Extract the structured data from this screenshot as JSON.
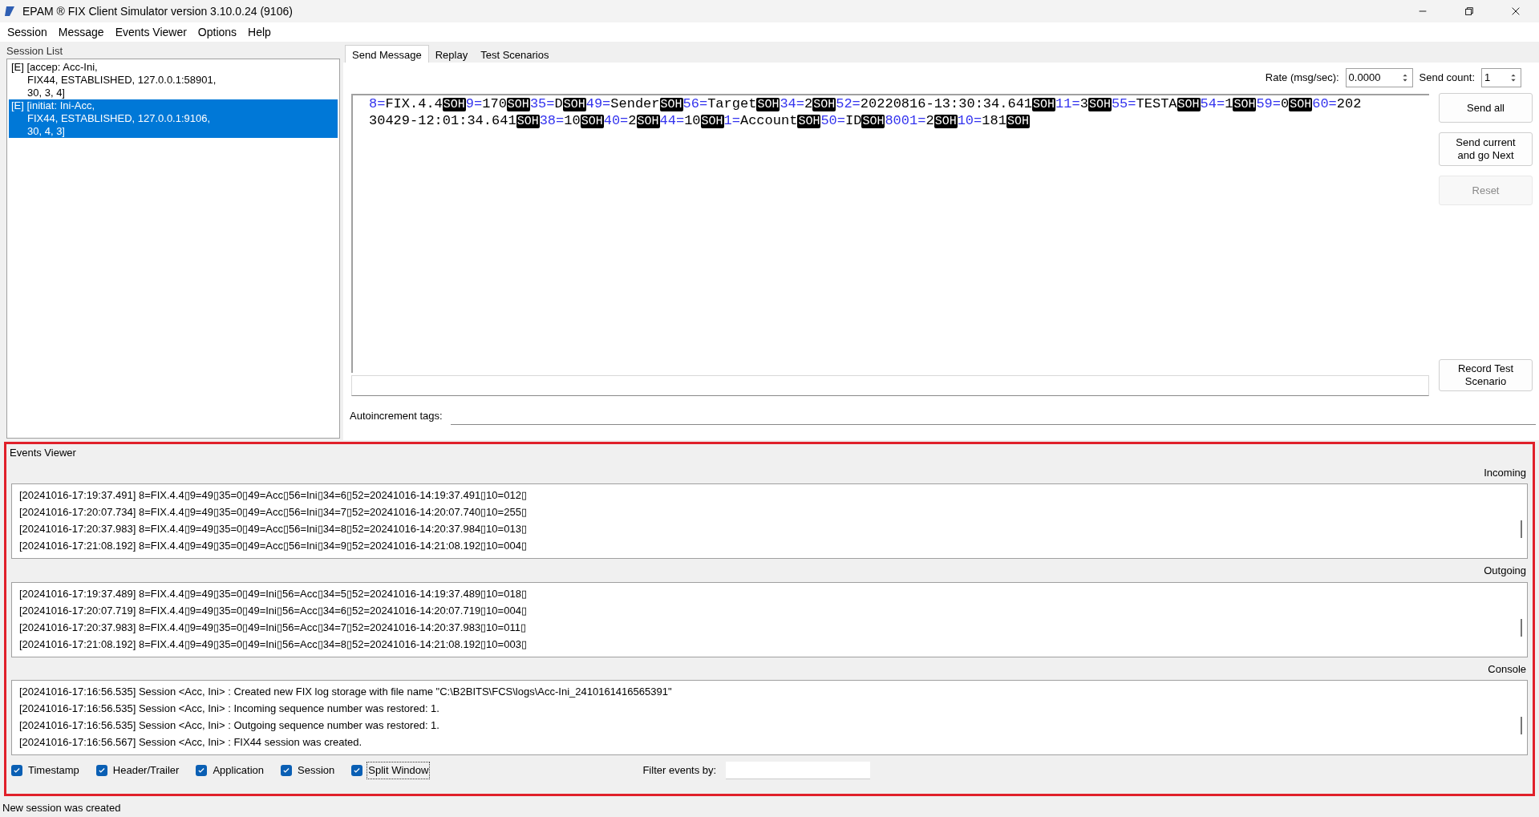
{
  "window": {
    "title": "EPAM ® FIX Client Simulator version 3.10.0.24 (9106)"
  },
  "menu": [
    "Session",
    "Message",
    "Events Viewer",
    "Options",
    "Help"
  ],
  "session_list": {
    "title": "Session List",
    "items": [
      {
        "lines": [
          "[E] [accep: Acc-Ini,",
          "FIX44, ESTABLISHED, 127.0.0.1:58901,",
          "30, 3, 4]"
        ],
        "selected": false
      },
      {
        "lines": [
          "[E] [initiat: Ini-Acc,",
          "FIX44, ESTABLISHED, 127.0.0.1:9106,",
          "30, 4, 3]"
        ],
        "selected": true
      }
    ]
  },
  "tabs": [
    {
      "label": "Send Message",
      "selected": true
    },
    {
      "label": "Replay",
      "selected": false
    },
    {
      "label": "Test Scenarios",
      "selected": false
    }
  ],
  "rate": {
    "label": "Rate (msg/sec):",
    "value": "0.0000"
  },
  "send_count": {
    "label": "Send count:",
    "value": "1"
  },
  "message": {
    "lines": [
      [
        {
          "tag": "8=",
          "value": "FIX.4.4",
          "soh": "SOH"
        },
        {
          "tag": "9=",
          "value": "170",
          "soh": "SOH"
        },
        {
          "tag": "35=",
          "value": "D",
          "soh": "SOH"
        },
        {
          "tag": "49=",
          "value": "Sender",
          "soh": "SOH"
        },
        {
          "tag": "56=",
          "value": "Target",
          "soh": "SOH"
        },
        {
          "tag": "34=",
          "value": "2",
          "soh": "SOH"
        },
        {
          "tag": "52=",
          "value": "20220816-13:30:34.641",
          "soh": "SOH"
        },
        {
          "tag": "11=",
          "value": "3",
          "soh": "SOH"
        },
        {
          "tag": "55=",
          "value": "TESTA",
          "soh": "SOH"
        },
        {
          "tag": "54=",
          "value": "1",
          "soh": "SOH"
        },
        {
          "tag": "59=",
          "value": "0",
          "soh": "SOH"
        },
        {
          "tag": "60=",
          "value": "202"
        }
      ],
      [
        {
          "value": "30429-12:01:34.641",
          "soh": "SOH"
        },
        {
          "tag": "38=",
          "value": "10",
          "soh": "SOH"
        },
        {
          "tag": "40=",
          "value": "2",
          "soh": "SOH"
        },
        {
          "tag": "44=",
          "value": "10",
          "soh": "SOH"
        },
        {
          "tag": "1=",
          "value": "Account",
          "soh": "SOH"
        },
        {
          "tag": "50=",
          "value": "ID",
          "soh": "SOH"
        },
        {
          "tag": "8001=",
          "value": "2",
          "soh": "SOH"
        },
        {
          "tag": "10=",
          "value": "181",
          "soh": "SOH"
        }
      ]
    ]
  },
  "buttons": [
    {
      "label": "Send all",
      "disabled": false
    },
    {
      "label": "Send current and go Next",
      "disabled": false
    },
    {
      "label": "Reset",
      "disabled": true
    }
  ],
  "record_button": {
    "label": "Record Test Scenario"
  },
  "autoincrement": {
    "label": "Autoincrement tags:"
  },
  "events_viewer": {
    "title": "Events Viewer",
    "panes": [
      {
        "label": "Incoming",
        "lines": [
          "[20241016-17:19:37.491] 8=FIX.4.4▯9=49▯35=0▯49=Acc▯56=Ini▯34=6▯52=20241016-14:19:37.491▯10=012▯",
          "[20241016-17:20:07.734] 8=FIX.4.4▯9=49▯35=0▯49=Acc▯56=Ini▯34=7▯52=20241016-14:20:07.740▯10=255▯",
          "[20241016-17:20:37.983] 8=FIX.4.4▯9=49▯35=0▯49=Acc▯56=Ini▯34=8▯52=20241016-14:20:37.984▯10=013▯",
          "[20241016-17:21:08.192] 8=FIX.4.4▯9=49▯35=0▯49=Acc▯56=Ini▯34=9▯52=20241016-14:21:08.192▯10=004▯"
        ]
      },
      {
        "label": "Outgoing",
        "lines": [
          "[20241016-17:19:37.489] 8=FIX.4.4▯9=49▯35=0▯49=Ini▯56=Acc▯34=5▯52=20241016-14:19:37.489▯10=018▯",
          "[20241016-17:20:07.719] 8=FIX.4.4▯9=49▯35=0▯49=Ini▯56=Acc▯34=6▯52=20241016-14:20:07.719▯10=004▯",
          "[20241016-17:20:37.983] 8=FIX.4.4▯9=49▯35=0▯49=Ini▯56=Acc▯34=7▯52=20241016-14:20:37.983▯10=011▯",
          "[20241016-17:21:08.192] 8=FIX.4.4▯9=49▯35=0▯49=Ini▯56=Acc▯34=8▯52=20241016-14:21:08.192▯10=003▯"
        ]
      },
      {
        "label": "Console",
        "lines": [
          "[20241016-17:16:56.535] Session <Acc, Ini> : Created new FIX log storage with file name \"C:\\B2BITS\\FCS\\logs\\Acc-Ini_2410161416565391\"",
          "[20241016-17:16:56.535] Session <Acc, Ini> : Incoming sequence number was restored: 1.",
          "[20241016-17:16:56.535] Session <Acc, Ini> : Outgoing sequence number was restored: 1.",
          "[20241016-17:16:56.567] Session <Acc, Ini> : FIX44 session was created."
        ]
      }
    ],
    "filters": [
      {
        "label": "Timestamp",
        "checked": true,
        "focused": false
      },
      {
        "label": "Header/Trailer",
        "checked": true,
        "focused": false
      },
      {
        "label": "Application",
        "checked": true,
        "focused": false
      },
      {
        "label": "Session",
        "checked": true,
        "focused": false
      },
      {
        "label": "Split Window",
        "checked": true,
        "focused": true
      }
    ],
    "filter_field": {
      "label": "Filter events by:"
    }
  },
  "status_bar": "New session was created"
}
